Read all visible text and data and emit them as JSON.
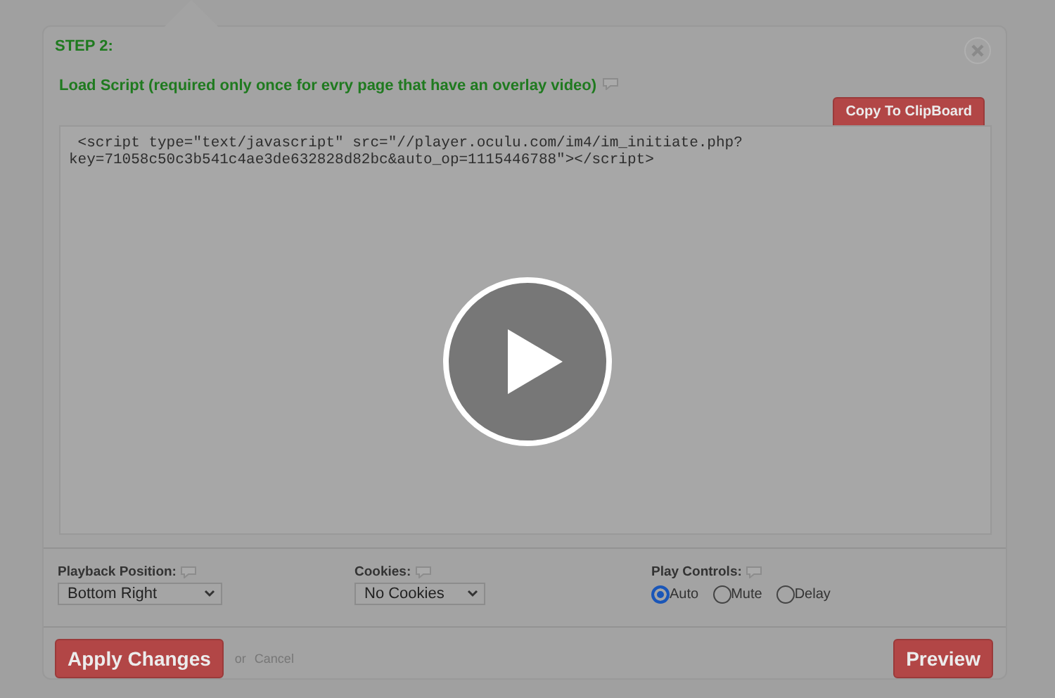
{
  "step_title": "STEP 2:",
  "load_label": "Load Script (required only once for evry page that have an overlay video)",
  "copy_button": "Copy To ClipBoard",
  "code_lines": [
    " <script type=\"text/javascript\" src=\"//player.oculu.com/im4/im_initiate.php?",
    "key=71058c50c3b541c4ae3de632828d82bc&auto_op=1115446788\"></script>"
  ],
  "options": [
    {
      "kind": "select",
      "label": "Playback Position:",
      "value": "Bottom Right"
    },
    {
      "kind": "select",
      "label": "Cookies:",
      "value": "No Cookies"
    },
    {
      "kind": "radios",
      "label": "Play Controls:",
      "choices": [
        {
          "label": "Auto",
          "selected": true
        },
        {
          "label": "Mute",
          "selected": false
        },
        {
          "label": "Delay",
          "selected": false
        }
      ]
    }
  ],
  "apply_button": "Apply Changes",
  "or_text": "or",
  "cancel_link": "Cancel",
  "preview_button": "Preview"
}
